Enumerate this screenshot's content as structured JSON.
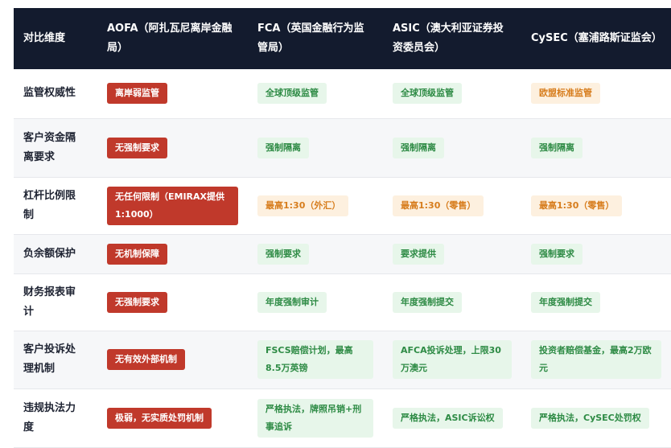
{
  "headers": [
    "对比维度",
    "AOFA（阿扎瓦尼离岸金融局）",
    "FCA（英国金融行为监管局）",
    "ASIC（澳大利亚证券投资委员会）",
    "CySEC（塞浦路斯证监会）"
  ],
  "rows": [
    {
      "label": "监管权威性",
      "cells": [
        {
          "text": "离岸弱监管",
          "tone": "bad"
        },
        {
          "text": "全球顶级监管",
          "tone": "good"
        },
        {
          "text": "全球顶级监管",
          "tone": "good"
        },
        {
          "text": "欧盟标准监管",
          "tone": "warn"
        }
      ]
    },
    {
      "label": "客户资金隔离要求",
      "cells": [
        {
          "text": "无强制要求",
          "tone": "bad"
        },
        {
          "text": "强制隔离",
          "tone": "good"
        },
        {
          "text": "强制隔离",
          "tone": "good"
        },
        {
          "text": "强制隔离",
          "tone": "good"
        }
      ]
    },
    {
      "label": "杠杆比例限制",
      "cells": [
        {
          "text": "无任何限制（EMIRAX提供1:1000）",
          "tone": "bad"
        },
        {
          "text": "最高1:30（外汇）",
          "tone": "warn"
        },
        {
          "text": "最高1:30（零售）",
          "tone": "warn"
        },
        {
          "text": "最高1:30（零售）",
          "tone": "warn"
        }
      ]
    },
    {
      "label": "负余额保护",
      "cells": [
        {
          "text": "无机制保障",
          "tone": "bad"
        },
        {
          "text": "强制要求",
          "tone": "good"
        },
        {
          "text": "要求提供",
          "tone": "good"
        },
        {
          "text": "强制要求",
          "tone": "good"
        }
      ]
    },
    {
      "label": "财务报表审计",
      "cells": [
        {
          "text": "无强制要求",
          "tone": "bad"
        },
        {
          "text": "年度强制审计",
          "tone": "good"
        },
        {
          "text": "年度强制提交",
          "tone": "good"
        },
        {
          "text": "年度强制提交",
          "tone": "good"
        }
      ]
    },
    {
      "label": "客户投诉处理机制",
      "cells": [
        {
          "text": "无有效外部机制",
          "tone": "bad"
        },
        {
          "text": "FSCS赔偿计划，最高8.5万英镑",
          "tone": "good"
        },
        {
          "text": "AFCA投诉处理，上限30万澳元",
          "tone": "good"
        },
        {
          "text": "投资者赔偿基金，最高2万欧元",
          "tone": "good"
        }
      ]
    },
    {
      "label": "违规执法力度",
      "cells": [
        {
          "text": "极弱，无实质处罚机制",
          "tone": "bad"
        },
        {
          "text": "严格执法，牌照吊销+刑事追诉",
          "tone": "good"
        },
        {
          "text": "严格执法，ASIC诉讼权",
          "tone": "good"
        },
        {
          "text": "严格执法，CySEC处罚权",
          "tone": "good"
        }
      ]
    }
  ],
  "colors": {
    "header_bg": "#131b2e",
    "bad": "#c0392b",
    "good_bg": "#e7f6ea",
    "good_text": "#2e8b45",
    "warn_bg": "#fdf0df",
    "warn_text": "#d77d1d"
  }
}
